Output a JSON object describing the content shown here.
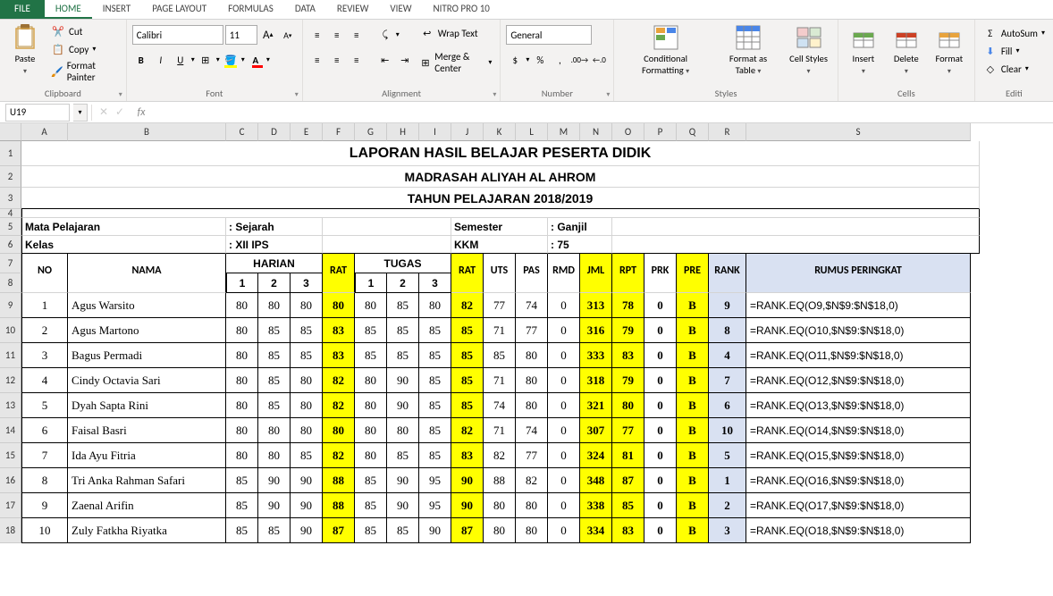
{
  "tabs": {
    "file": "FILE",
    "home": "HOME",
    "insert": "INSERT",
    "page_layout": "PAGE LAYOUT",
    "formulas": "FORMULAS",
    "data": "DATA",
    "review": "REVIEW",
    "view": "VIEW",
    "nitro": "NITRO PRO 10"
  },
  "ribbon": {
    "clipboard": {
      "paste": "Paste",
      "cut": "Cut",
      "copy": "Copy",
      "format_painter": "Format Painter",
      "label": "Clipboard"
    },
    "font": {
      "name": "Calibri",
      "size": "11",
      "label": "Font"
    },
    "alignment": {
      "wrap": "Wrap Text",
      "merge": "Merge & Center",
      "label": "Alignment"
    },
    "number": {
      "format": "General",
      "label": "Number"
    },
    "styles": {
      "cond": "Conditional Formatting",
      "table": "Format as Table",
      "cell": "Cell Styles",
      "label": "Styles"
    },
    "cells": {
      "insert": "Insert",
      "delete": "Delete",
      "format": "Format",
      "label": "Cells"
    },
    "editing": {
      "autosum": "AutoSum",
      "fill": "Fill",
      "clear": "Clear",
      "label": "Editi"
    }
  },
  "namebox": "U19",
  "report": {
    "title1": "LAPORAN HASIL BELAJAR PESERTA DIDIK",
    "title2": "MADRASAH ALIYAH AL AHROM",
    "title3": "TAHUN PELAJARAN 2018/2019",
    "mapel_label": "Mata Pelajaran",
    "mapel": ": Sejarah",
    "kelas_label": "Kelas",
    "kelas": ": XII IPS",
    "semester_label": "Semester",
    "semester": ": Ganjil",
    "kkm_label": "KKM",
    "kkm": ": 75",
    "h_no": "NO",
    "h_nama": "NAMA",
    "h_harian": "HARIAN",
    "h_rat": "RAT",
    "h_tugas": "TUGAS",
    "h_uts": "UTS",
    "h_pas": "PAS",
    "h_rmd": "RMD",
    "h_jml": "JML",
    "h_rpt": "RPT",
    "h_prk": "PRK",
    "h_pre": "PRE",
    "h_rank": "RANK",
    "h_rumus": "RUMUS PERINGKAT",
    "n1": "1",
    "n2": "2",
    "n3": "3"
  },
  "chart_data": {
    "type": "table",
    "columns": [
      "NO",
      "NAMA",
      "H1",
      "H2",
      "H3",
      "RAT_H",
      "T1",
      "T2",
      "T3",
      "RAT_T",
      "UTS",
      "PAS",
      "RMD",
      "JML",
      "RPT",
      "PRK",
      "PRE",
      "RANK",
      "RUMUS"
    ],
    "rows": [
      [
        1,
        "Agus Warsito",
        80,
        80,
        80,
        80,
        80,
        85,
        80,
        82,
        77,
        74,
        0,
        313,
        78,
        0,
        "B",
        9,
        "=RANK.EQ(O9,$N$9:$N$18,0)"
      ],
      [
        2,
        "Agus Martono",
        80,
        85,
        85,
        83,
        85,
        85,
        85,
        85,
        71,
        77,
        0,
        316,
        79,
        0,
        "B",
        8,
        "=RANK.EQ(O10,$N$9:$N$18,0)"
      ],
      [
        3,
        "Bagus Permadi",
        80,
        85,
        85,
        83,
        85,
        85,
        85,
        85,
        85,
        80,
        0,
        333,
        83,
        0,
        "B",
        4,
        "=RANK.EQ(O11,$N$9:$N$18,0)"
      ],
      [
        4,
        "Cindy Octavia Sari",
        80,
        85,
        80,
        82,
        80,
        90,
        85,
        85,
        71,
        80,
        0,
        318,
        79,
        0,
        "B",
        7,
        "=RANK.EQ(O12,$N$9:$N$18,0)"
      ],
      [
        5,
        "Dyah Sapta Rini",
        80,
        85,
        80,
        82,
        80,
        90,
        85,
        85,
        74,
        80,
        0,
        321,
        80,
        0,
        "B",
        6,
        "=RANK.EQ(O13,$N$9:$N$18,0)"
      ],
      [
        6,
        "Faisal Basri",
        80,
        80,
        80,
        80,
        80,
        80,
        85,
        82,
        71,
        74,
        0,
        307,
        77,
        0,
        "B",
        10,
        "=RANK.EQ(O14,$N$9:$N$18,0)"
      ],
      [
        7,
        "Ida Ayu Fitria",
        80,
        80,
        85,
        82,
        80,
        85,
        85,
        83,
        82,
        77,
        0,
        324,
        81,
        0,
        "B",
        5,
        "=RANK.EQ(O15,$N$9:$N$18,0)"
      ],
      [
        8,
        "Tri Anka Rahman Safari",
        85,
        90,
        90,
        88,
        85,
        90,
        95,
        90,
        88,
        82,
        0,
        348,
        87,
        0,
        "B",
        1,
        "=RANK.EQ(O16,$N$9:$N$18,0)"
      ],
      [
        9,
        "Zaenal Arifin",
        85,
        90,
        90,
        88,
        85,
        90,
        95,
        90,
        80,
        80,
        0,
        338,
        85,
        0,
        "B",
        2,
        "=RANK.EQ(O17,$N$9:$N$18,0)"
      ],
      [
        10,
        "Zuly Fatkha Riyatka",
        85,
        85,
        90,
        87,
        85,
        85,
        90,
        87,
        80,
        80,
        0,
        334,
        83,
        0,
        "B",
        3,
        "=RANK.EQ(O18,$N$9:$N$18,0)"
      ]
    ]
  }
}
